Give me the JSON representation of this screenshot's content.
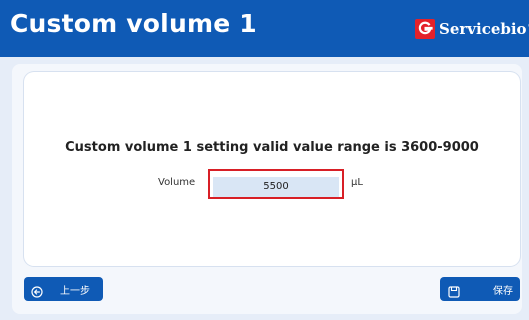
{
  "header": {
    "title": "Custom volume 1",
    "brand": {
      "logo_letter": "G",
      "name": "Servicebio",
      "registered": "®",
      "logo_color": "#e4212a"
    },
    "background_color": "#0f5ab5"
  },
  "main": {
    "message": "Custom volume 1 setting valid value range is 3600-9000",
    "volume": {
      "label": "Volume",
      "value": "5500",
      "unit": "μL",
      "highlight_color": "#d81f26"
    }
  },
  "footer": {
    "back_button": {
      "label": "上一步",
      "icon": "back-arrow-circle-icon"
    },
    "save_button": {
      "label": "保存",
      "icon": "save-disk-icon"
    }
  }
}
